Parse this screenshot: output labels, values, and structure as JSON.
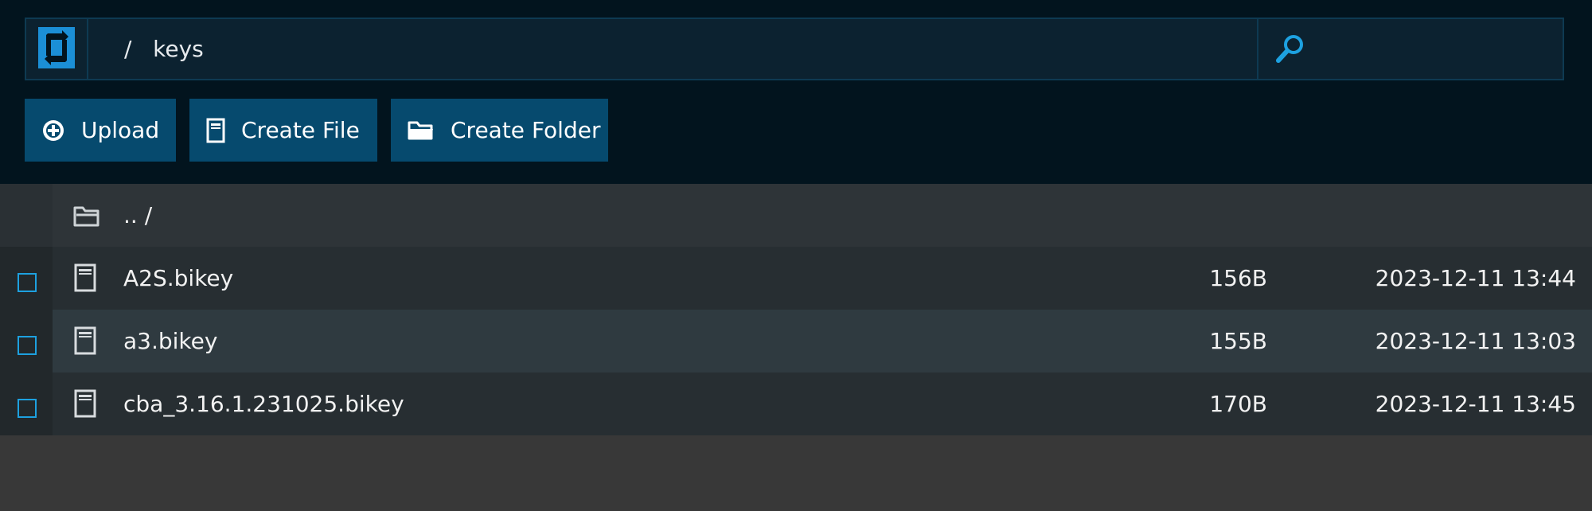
{
  "path": {
    "separator": "/",
    "current": "keys"
  },
  "search": {
    "placeholder": ""
  },
  "actions": {
    "upload_label": "Upload",
    "create_file_label": "Create File",
    "create_folder_label": "Create Folder"
  },
  "parent": {
    "label": ".. /"
  },
  "files": [
    {
      "name": "A2S.bikey",
      "size": "156B",
      "modified": "2023-12-11 13:44"
    },
    {
      "name": "a3.bikey",
      "size": "155B",
      "modified": "2023-12-11 13:03"
    },
    {
      "name": "cba_3.16.1.231025.bikey",
      "size": "170B",
      "modified": "2023-12-11 13:45"
    }
  ],
  "colors": {
    "header_bg": "#02141e",
    "button_bg": "#064a6e",
    "accent": "#1da1e0",
    "list_bg": "#383838"
  },
  "icons": {
    "refresh": "refresh-icon",
    "search": "search-icon",
    "upload": "plus-circle-icon",
    "file": "file-icon",
    "folder": "folder-icon"
  }
}
